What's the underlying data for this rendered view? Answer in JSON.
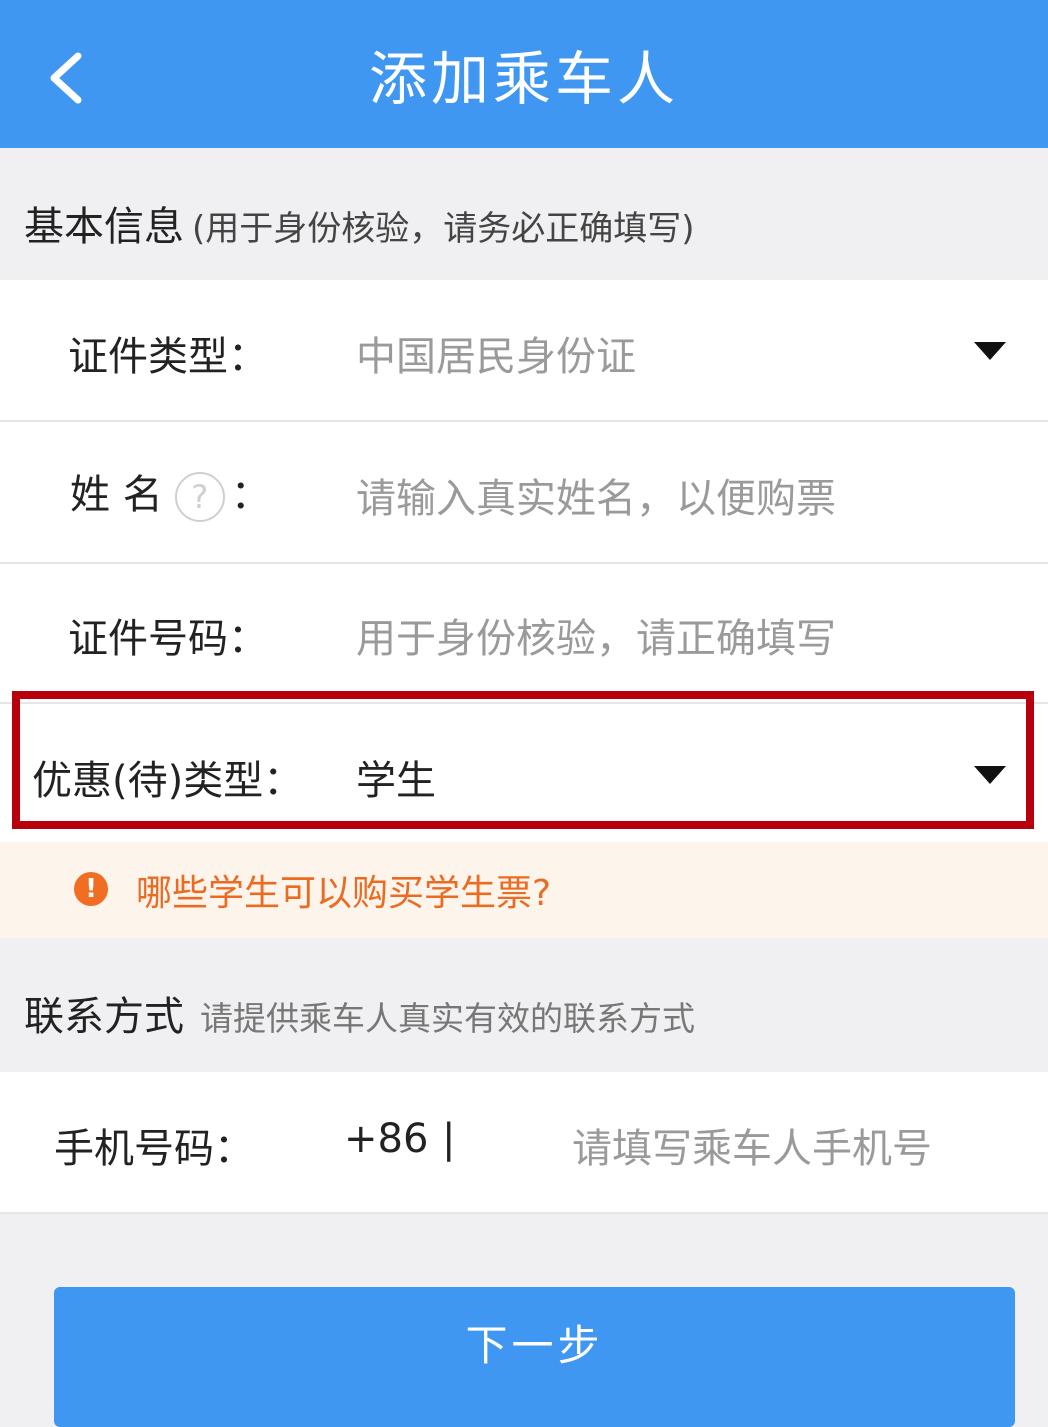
{
  "header": {
    "title": "添加乘车人",
    "back_icon": "chevron-left-icon"
  },
  "basic_info": {
    "title": "基本信息",
    "subtitle": "(用于身份核验，请务必正确填写)"
  },
  "form": {
    "id_type": {
      "label": "证件类型：",
      "value": "中国居民身份证"
    },
    "name": {
      "label_part1": "姓 名",
      "help_glyph": "?",
      "label_colon": "：",
      "placeholder": "请输入真实姓名，以便购票"
    },
    "id_number": {
      "label": "证件号码：",
      "placeholder": "用于身份核验，请正确填写"
    },
    "discount_type": {
      "label": "优惠(待)类型：",
      "value": "学生"
    }
  },
  "notice": {
    "icon": "exclamation-circle-icon",
    "glyph": "!",
    "text": "哪些学生可以购买学生票?"
  },
  "contact": {
    "title": "联系方式",
    "subtitle": "请提供乘车人真实有效的联系方式",
    "phone_label": "手机号码：",
    "country_code": "+86",
    "separator": "|",
    "phone_placeholder": "请填写乘车人手机号"
  },
  "next_button": "下一步",
  "colors": {
    "primary": "#3f97f2",
    "highlight_border": "#b8000c",
    "notice_bg": "#fdf4ec",
    "notice_text": "#ec6b22"
  }
}
